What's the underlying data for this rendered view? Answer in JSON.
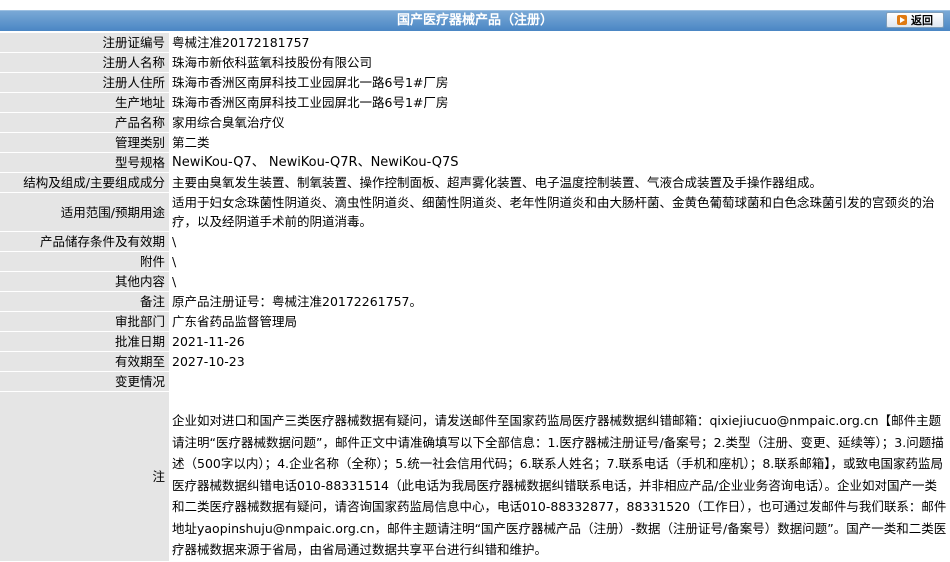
{
  "header": {
    "title": "国产医疗器械产品（注册）",
    "back_label": "返回"
  },
  "rows": [
    {
      "label": "注册证编号",
      "value": "粤械注准20172181757"
    },
    {
      "label": "注册人名称",
      "value": "珠海市新依科蓝氧科技股份有限公司"
    },
    {
      "label": "注册人住所",
      "value": "珠海市香洲区南屏科技工业园屏北一路6号1#厂房"
    },
    {
      "label": "生产地址",
      "value": "珠海市香洲区南屏科技工业园屏北一路6号1#厂房"
    },
    {
      "label": "产品名称",
      "value": "家用综合臭氧治疗仪"
    },
    {
      "label": "管理类别",
      "value": "第二类"
    },
    {
      "label": "型号规格",
      "value": "NewiKou-Q7、 NewiKou-Q7R、NewiKou-Q7S"
    },
    {
      "label": "结构及组成/主要组成成分",
      "value": "主要由臭氧发生装置、制氧装置、操作控制面板、超声雾化装置、电子温度控制装置、气液合成装置及手操作器组成。"
    },
    {
      "label": "适用范围/预期用途",
      "value": "适用于妇女念珠菌性阴道炎、滴虫性阴道炎、细菌性阴道炎、老年性阴道炎和由大肠杆菌、金黄色葡萄球菌和白色念珠菌引发的宫颈炎的治疗，以及经阴道手术前的阴道消毒。"
    },
    {
      "label": "产品储存条件及有效期",
      "value": "\\"
    },
    {
      "label": "附件",
      "value": "\\"
    },
    {
      "label": "其他内容",
      "value": "\\"
    },
    {
      "label": "备注",
      "value": "原产品注册证号：粤械注准20172261757。"
    },
    {
      "label": "审批部门",
      "value": "广东省药品监督管理局"
    },
    {
      "label": "批准日期",
      "value": "2021-11-26"
    },
    {
      "label": "有效期至",
      "value": "2027-10-23"
    },
    {
      "label": "变更情况",
      "value": ""
    },
    {
      "label": "注",
      "value": "企业如对进口和国产三类医疗器械数据有疑问，请发送邮件至国家药监局医疗器械数据纠错邮箱：qixiejiucuo@nmpaic.org.cn【邮件主题请注明“医疗器械数据问题”，邮件正文中请准确填写以下全部信息：1.医疗器械注册证号/备案号；2.类型（注册、变更、延续等）；3.问题描述（500字以内）；4.企业名称（全称）；5.统一社会信用代码；6.联系人姓名；7.联系电话（手机和座机）；8.联系邮箱】，或致电国家药监局医疗器械数据纠错电话010-88331514（此电话为我局医疗器械数据纠错联系电话，并非相应产品/企业业务咨询电话）。企业如对国产一类和二类医疗器械数据有疑问，请咨询国家药监局信息中心，电话010-88332877，88331520（工作日），也可通过发邮件与我们联系：邮件地址yaopinshuju@nmpaic.org.cn，邮件主题请注明“国产医疗器械产品（注册）-数据（注册证号/备案号）数据问题”。国产一类和二类医疗器械数据来源于省局，由省局通过数据共享平台进行纠错和维护。"
    }
  ]
}
